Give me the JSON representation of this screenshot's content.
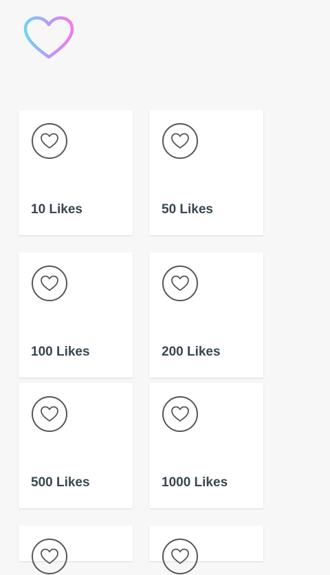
{
  "app": {
    "logo_icon": "heart-outline-gradient-icon",
    "logo_gradient": [
      "#6fd3f5",
      "#b59af5",
      "#f07be8"
    ]
  },
  "packages": [
    {
      "label": "10 Likes",
      "icon": "heart-icon"
    },
    {
      "label": "50 Likes",
      "icon": "heart-icon"
    },
    {
      "label": "100 Likes",
      "icon": "heart-icon"
    },
    {
      "label": "200 Likes",
      "icon": "heart-icon"
    },
    {
      "label": "500 Likes",
      "icon": "heart-icon"
    },
    {
      "label": "1000 Likes",
      "icon": "heart-icon"
    },
    {
      "label": "",
      "icon": "heart-icon"
    },
    {
      "label": "",
      "icon": "heart-icon"
    }
  ],
  "colors": {
    "background": "#f7f7f8",
    "card": "#ffffff",
    "label_text": "#37474f",
    "icon_stroke": "#555555"
  }
}
